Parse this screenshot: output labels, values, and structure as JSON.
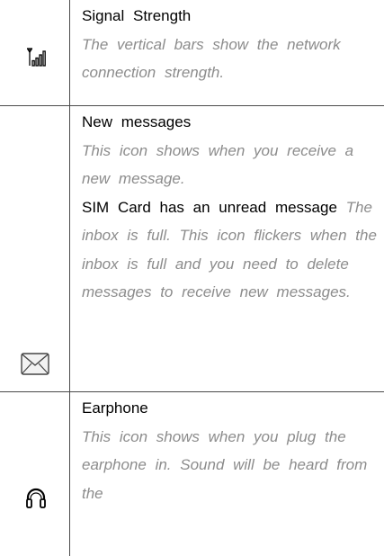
{
  "rows": [
    {
      "icon": "signal-strength-icon",
      "title": "Signal Strength",
      "description": "The vertical bars show the network connection strength."
    },
    {
      "icon": "envelope-message-icon",
      "title": "New messages",
      "description": "This icon shows when you receive a new message.",
      "title2": "SIM Card has an unread message",
      "description2": "The inbox is full. This icon flickers when the inbox is full and you need to delete messages to receive new messages."
    },
    {
      "icon": "headphones-icon",
      "title": "Earphone",
      "description": "This icon shows when you plug the earphone in. Sound will be heard from the"
    }
  ]
}
